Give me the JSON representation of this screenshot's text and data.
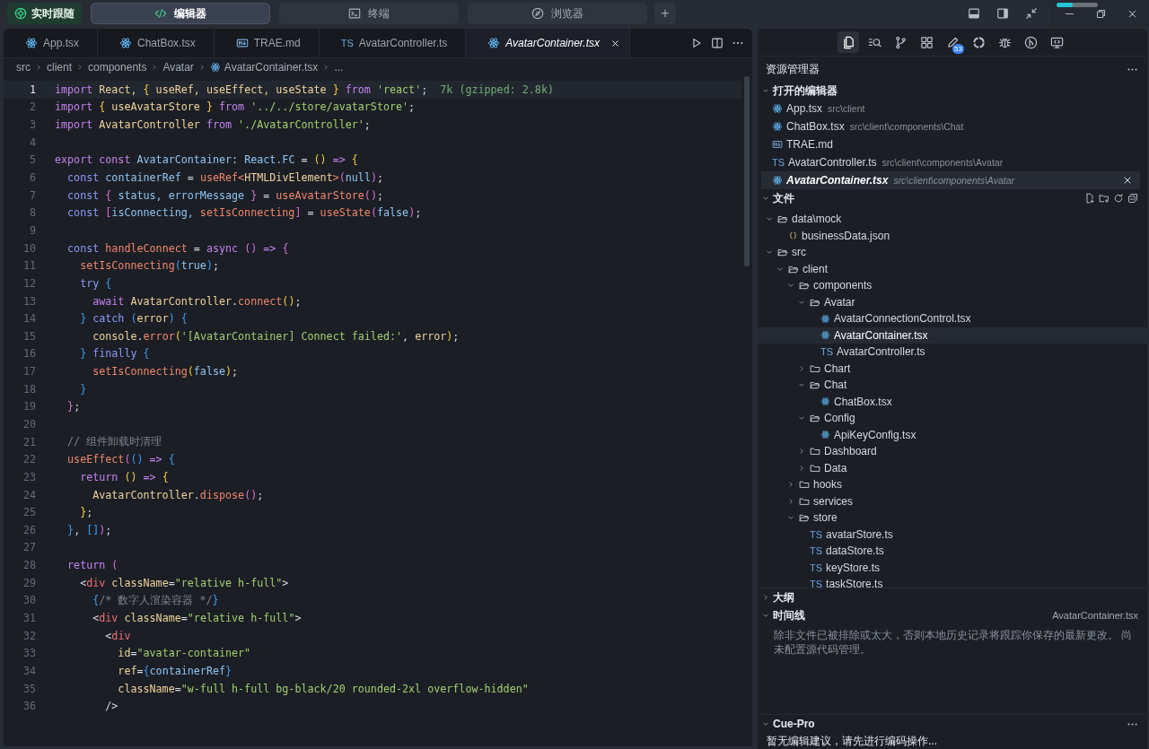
{
  "top_bar": {
    "follow_button": {
      "label": "实时跟随"
    },
    "modes": [
      {
        "label": "编辑器",
        "selected": true
      },
      {
        "label": "终端",
        "selected": false
      },
      {
        "label": "浏览器",
        "selected": false
      }
    ],
    "add_button": {
      "label": "+"
    },
    "progress": {
      "level": 0.4
    }
  },
  "editor": {
    "tabs": [
      {
        "label": "App.tsx",
        "kind": "react",
        "selected": false
      },
      {
        "label": "ChatBox.tsx",
        "kind": "react",
        "selected": false
      },
      {
        "label": "TRAE.md",
        "kind": "markdown",
        "selected": false
      },
      {
        "label": "AvatarController.ts",
        "kind": "typescript",
        "tag": "TS",
        "selected": false
      },
      {
        "label": "AvatarContainer.tsx",
        "kind": "react",
        "selected": true
      }
    ],
    "breadcrumb": [
      {
        "label": "src",
        "kind": "folder"
      },
      {
        "label": "client",
        "kind": "folder"
      },
      {
        "label": "components",
        "kind": "folder"
      },
      {
        "label": "Avatar",
        "kind": "folder"
      },
      {
        "label": "AvatarContainer.tsx",
        "kind": "react"
      },
      {
        "label": "...",
        "kind": "more"
      }
    ],
    "lines": [
      {
        "number": "1",
        "current": true,
        "tokens": [
          {
            "text": "import",
            "kind": "keyword"
          },
          {
            "text": " React, ",
            "kind": "class"
          },
          {
            "text": "{",
            "kind": "brace1"
          },
          {
            "text": " useRef, useEffect, useState ",
            "kind": "class"
          },
          {
            "text": "}",
            "kind": "brace1"
          },
          {
            "text": " from",
            "kind": "keyword"
          },
          {
            "text": " 'react'",
            "kind": "string"
          },
          {
            "text": ";",
            "kind": "plain"
          },
          {
            "text": "  7k (gzipped: 2.8k)",
            "kind": "hint"
          }
        ]
      },
      {
        "number": "2",
        "current": false,
        "tokens": [
          {
            "text": "import",
            "kind": "keyword"
          },
          {
            "text": " {",
            "kind": "brace1"
          },
          {
            "text": " useAvatarStore ",
            "kind": "class"
          },
          {
            "text": "}",
            "kind": "brace1"
          },
          {
            "text": " from",
            "kind": "keyword"
          },
          {
            "text": " '../../store/avatarStore'",
            "kind": "string"
          },
          {
            "text": ";",
            "kind": "plain"
          }
        ]
      },
      {
        "number": "3",
        "current": false,
        "tokens": [
          {
            "text": "import",
            "kind": "keyword"
          },
          {
            "text": " AvatarController",
            "kind": "class"
          },
          {
            "text": " from",
            "kind": "keyword"
          },
          {
            "text": " './AvatarController'",
            "kind": "string"
          },
          {
            "text": ";",
            "kind": "plain"
          }
        ]
      },
      {
        "number": "4",
        "current": false
      },
      {
        "number": "5",
        "current": false,
        "tokens": [
          {
            "text": "export const",
            "kind": "keyword"
          },
          {
            "text": " AvatarContainer",
            "kind": "variable"
          },
          {
            "text": ": ",
            "kind": "plain"
          },
          {
            "text": "React.FC",
            "kind": "variable"
          },
          {
            "text": " = ",
            "kind": "plain"
          },
          {
            "text": "()",
            "kind": "brace1"
          },
          {
            "text": " =>",
            "kind": "keyword"
          },
          {
            "text": " {",
            "kind": "brace1"
          }
        ]
      },
      {
        "number": "6",
        "current": false,
        "tokens": [
          {
            "text": "  const",
            "kind": "declaration"
          },
          {
            "text": " containerRef",
            "kind": "variable"
          },
          {
            "text": " = ",
            "kind": "plain"
          },
          {
            "text": "useRef",
            "kind": "function"
          },
          {
            "text": "<",
            "kind": "function"
          },
          {
            "text": "HTMLDivElement",
            "kind": "class"
          },
          {
            "text": ">",
            "kind": "function"
          },
          {
            "text": "(",
            "kind": "brace2"
          },
          {
            "text": "null",
            "kind": "variable"
          },
          {
            "text": ")",
            "kind": "brace2"
          },
          {
            "text": ";",
            "kind": "plain"
          }
        ]
      },
      {
        "number": "7",
        "current": false,
        "tokens": [
          {
            "text": "  const",
            "kind": "declaration"
          },
          {
            "text": " {",
            "kind": "brace2"
          },
          {
            "text": " status, errorMessage ",
            "kind": "variable"
          },
          {
            "text": "}",
            "kind": "brace2"
          },
          {
            "text": " = ",
            "kind": "plain"
          },
          {
            "text": "useAvatarStore",
            "kind": "function"
          },
          {
            "text": "()",
            "kind": "brace2"
          },
          {
            "text": ";",
            "kind": "plain"
          }
        ]
      },
      {
        "number": "8",
        "current": false,
        "tokens": [
          {
            "text": "  const",
            "kind": "declaration"
          },
          {
            "text": " [",
            "kind": "brace2"
          },
          {
            "text": "isConnecting, ",
            "kind": "variable"
          },
          {
            "text": "setIsConnecting",
            "kind": "function"
          },
          {
            "text": "]",
            "kind": "brace2"
          },
          {
            "text": " = ",
            "kind": "plain"
          },
          {
            "text": "useState",
            "kind": "function"
          },
          {
            "text": "(",
            "kind": "brace2"
          },
          {
            "text": "false",
            "kind": "variable"
          },
          {
            "text": ")",
            "kind": "brace2"
          },
          {
            "text": ";",
            "kind": "plain"
          }
        ]
      },
      {
        "number": "9",
        "current": false
      },
      {
        "number": "10",
        "current": false,
        "tokens": [
          {
            "text": "  const",
            "kind": "declaration"
          },
          {
            "text": " handleConnect",
            "kind": "function"
          },
          {
            "text": " = ",
            "kind": "plain"
          },
          {
            "text": "async",
            "kind": "keyword"
          },
          {
            "text": " ()",
            "kind": "brace2"
          },
          {
            "text": " =>",
            "kind": "keyword"
          },
          {
            "text": " {",
            "kind": "brace2"
          }
        ]
      },
      {
        "number": "11",
        "current": false,
        "tokens": [
          {
            "text": "    setIsConnecting",
            "kind": "function"
          },
          {
            "text": "(",
            "kind": "brace3"
          },
          {
            "text": "true",
            "kind": "variable"
          },
          {
            "text": ")",
            "kind": "brace3"
          },
          {
            "text": ";",
            "kind": "plain"
          }
        ]
      },
      {
        "number": "12",
        "current": false,
        "tokens": [
          {
            "text": "    try",
            "kind": "declaration"
          },
          {
            "text": " {",
            "kind": "brace3"
          }
        ]
      },
      {
        "number": "13",
        "current": false,
        "tokens": [
          {
            "text": "      await",
            "kind": "keyword"
          },
          {
            "text": " AvatarController",
            "kind": "class"
          },
          {
            "text": ".",
            "kind": "plain"
          },
          {
            "text": "connect",
            "kind": "function"
          },
          {
            "text": "()",
            "kind": "brace1"
          },
          {
            "text": ";",
            "kind": "plain"
          }
        ]
      },
      {
        "number": "14",
        "current": false,
        "tokens": [
          {
            "text": "    }",
            "kind": "brace3"
          },
          {
            "text": " catch",
            "kind": "declaration"
          },
          {
            "text": " (",
            "kind": "brace3"
          },
          {
            "text": "error",
            "kind": "class"
          },
          {
            "text": ")",
            "kind": "brace3"
          },
          {
            "text": " {",
            "kind": "brace3"
          }
        ]
      },
      {
        "number": "15",
        "current": false,
        "tokens": [
          {
            "text": "      console",
            "kind": "class"
          },
          {
            "text": ".",
            "kind": "plain"
          },
          {
            "text": "error",
            "kind": "function"
          },
          {
            "text": "(",
            "kind": "brace1"
          },
          {
            "text": "'[AvatarContainer] Connect failed:'",
            "kind": "string"
          },
          {
            "text": ", ",
            "kind": "plain"
          },
          {
            "text": "error",
            "kind": "class"
          },
          {
            "text": ")",
            "kind": "brace1"
          },
          {
            "text": ";",
            "kind": "plain"
          }
        ]
      },
      {
        "number": "16",
        "current": false,
        "tokens": [
          {
            "text": "    }",
            "kind": "brace3"
          },
          {
            "text": " finally",
            "kind": "declaration"
          },
          {
            "text": " {",
            "kind": "brace3"
          }
        ]
      },
      {
        "number": "17",
        "current": false,
        "tokens": [
          {
            "text": "      setIsConnecting",
            "kind": "function"
          },
          {
            "text": "(",
            "kind": "brace1"
          },
          {
            "text": "false",
            "kind": "variable"
          },
          {
            "text": ")",
            "kind": "brace1"
          },
          {
            "text": ";",
            "kind": "plain"
          }
        ]
      },
      {
        "number": "18",
        "current": false,
        "tokens": [
          {
            "text": "    }",
            "kind": "brace3"
          }
        ]
      },
      {
        "number": "19",
        "current": false,
        "tokens": [
          {
            "text": "  }",
            "kind": "brace2"
          },
          {
            "text": ";",
            "kind": "plain"
          }
        ]
      },
      {
        "number": "20",
        "current": false
      },
      {
        "number": "21",
        "current": false,
        "tokens": [
          {
            "text": "  // 组件卸载时清理",
            "kind": "comment"
          }
        ]
      },
      {
        "number": "22",
        "current": false,
        "tokens": [
          {
            "text": "  useEffect",
            "kind": "function"
          },
          {
            "text": "(",
            "kind": "brace2"
          },
          {
            "text": "()",
            "kind": "brace3"
          },
          {
            "text": " =>",
            "kind": "keyword"
          },
          {
            "text": " {",
            "kind": "brace3"
          }
        ]
      },
      {
        "number": "23",
        "current": false,
        "tokens": [
          {
            "text": "    return",
            "kind": "keyword"
          },
          {
            "text": " ()",
            "kind": "brace1"
          },
          {
            "text": " =>",
            "kind": "keyword"
          },
          {
            "text": " {",
            "kind": "brace1"
          }
        ]
      },
      {
        "number": "24",
        "current": false,
        "tokens": [
          {
            "text": "      AvatarController",
            "kind": "class"
          },
          {
            "text": ".",
            "kind": "plain"
          },
          {
            "text": "dispose",
            "kind": "function"
          },
          {
            "text": "()",
            "kind": "brace2"
          },
          {
            "text": ";",
            "kind": "plain"
          }
        ]
      },
      {
        "number": "25",
        "current": false,
        "tokens": [
          {
            "text": "    }",
            "kind": "brace1"
          },
          {
            "text": ";",
            "kind": "plain"
          }
        ]
      },
      {
        "number": "26",
        "current": false,
        "tokens": [
          {
            "text": "  }",
            "kind": "brace3"
          },
          {
            "text": ", ",
            "kind": "plain"
          },
          {
            "text": "[]",
            "kind": "brace3"
          },
          {
            "text": ")",
            "kind": "brace2"
          },
          {
            "text": ";",
            "kind": "plain"
          }
        ]
      },
      {
        "number": "27",
        "current": false
      },
      {
        "number": "28",
        "current": false,
        "tokens": [
          {
            "text": "  return",
            "kind": "keyword"
          },
          {
            "text": " (",
            "kind": "brace2"
          }
        ]
      },
      {
        "number": "29",
        "current": false,
        "tokens": [
          {
            "text": "    <",
            "kind": "plain"
          },
          {
            "text": "div",
            "kind": "tag"
          },
          {
            "text": " className",
            "kind": "attribute"
          },
          {
            "text": "=",
            "kind": "plain"
          },
          {
            "text": "\"relative h-full\"",
            "kind": "string"
          },
          {
            "text": ">",
            "kind": "plain"
          }
        ]
      },
      {
        "number": "30",
        "current": false,
        "tokens": [
          {
            "text": "      {",
            "kind": "brace3"
          },
          {
            "text": "/* 数字人渲染容器 */",
            "kind": "comment"
          },
          {
            "text": "}",
            "kind": "brace3"
          }
        ]
      },
      {
        "number": "31",
        "current": false,
        "tokens": [
          {
            "text": "      <",
            "kind": "plain"
          },
          {
            "text": "div",
            "kind": "tag"
          },
          {
            "text": " className",
            "kind": "attribute"
          },
          {
            "text": "=",
            "kind": "plain"
          },
          {
            "text": "\"relative h-full\"",
            "kind": "string"
          },
          {
            "text": ">",
            "kind": "plain"
          }
        ]
      },
      {
        "number": "32",
        "current": false,
        "tokens": [
          {
            "text": "        <",
            "kind": "plain"
          },
          {
            "text": "div",
            "kind": "tag"
          }
        ]
      },
      {
        "number": "33",
        "current": false,
        "tokens": [
          {
            "text": "          id",
            "kind": "attribute"
          },
          {
            "text": "=",
            "kind": "plain"
          },
          {
            "text": "\"avatar-container\"",
            "kind": "string"
          }
        ]
      },
      {
        "number": "34",
        "current": false,
        "tokens": [
          {
            "text": "          ref",
            "kind": "attribute"
          },
          {
            "text": "=",
            "kind": "plain"
          },
          {
            "text": "{",
            "kind": "brace3"
          },
          {
            "text": "containerRef",
            "kind": "variable"
          },
          {
            "text": "}",
            "kind": "brace3"
          }
        ]
      },
      {
        "number": "35",
        "current": false,
        "tokens": [
          {
            "text": "          className",
            "kind": "attribute"
          },
          {
            "text": "=",
            "kind": "plain"
          },
          {
            "text": "\"w-full h-full bg-black/20 rounded-2xl overflow-hidden\"",
            "kind": "string"
          }
        ]
      },
      {
        "number": "36",
        "current": false,
        "tokens": [
          {
            "text": "        />",
            "kind": "plain"
          }
        ]
      }
    ]
  },
  "sidebar": {
    "activity_bar": [
      {
        "selected": true
      },
      {
        "selected": false
      },
      {
        "selected": false
      },
      {
        "selected": false
      },
      {
        "selected": false,
        "badge": "53"
      },
      {
        "selected": false
      },
      {
        "selected": false
      },
      {
        "selected": false
      },
      {
        "selected": false
      }
    ],
    "title": "资源管理器",
    "open_editors": {
      "title": "打开的编辑器",
      "expanded": true,
      "items": [
        {
          "name": "App.tsx",
          "path": "src\\client",
          "kind": "react",
          "selected": false
        },
        {
          "name": "ChatBox.tsx",
          "path": "src\\client\\components\\Chat",
          "kind": "react",
          "selected": false
        },
        {
          "name": "TRAE.md",
          "kind": "markdown",
          "selected": false
        },
        {
          "name": "AvatarController.ts",
          "path": "src\\client\\components\\Avatar",
          "kind": "typescript",
          "tag": "TS",
          "selected": false
        },
        {
          "name": "AvatarContainer.tsx",
          "path": "src\\client\\components\\Avatar",
          "kind": "react",
          "selected": true
        }
      ]
    },
    "files": {
      "title": "文件",
      "expanded": true,
      "tree": [
        {
          "label": "data\\mock",
          "kind": "folder",
          "expanded": true,
          "selected": false,
          "children": [
            {
              "label": "businessData.json",
              "kind": "json",
              "selected": false
            }
          ]
        },
        {
          "label": "src",
          "kind": "folder",
          "expanded": true,
          "selected": false,
          "children": [
            {
              "label": "client",
              "kind": "folder",
              "expanded": true,
              "selected": false,
              "children": [
                {
                  "label": "components",
                  "kind": "folder",
                  "expanded": true,
                  "selected": false,
                  "children": [
                    {
                      "label": "Avatar",
                      "kind": "folder",
                      "expanded": true,
                      "selected": false,
                      "children": [
                        {
                          "label": "AvatarConnectionControl.tsx",
                          "kind": "react",
                          "selected": false
                        },
                        {
                          "label": "AvatarContainer.tsx",
                          "kind": "react",
                          "selected": true
                        },
                        {
                          "label": "AvatarController.ts",
                          "kind": "typescript",
                          "tag": "TS",
                          "selected": false
                        }
                      ]
                    },
                    {
                      "label": "Chart",
                      "kind": "folder",
                      "expanded": false,
                      "selected": false
                    },
                    {
                      "label": "Chat",
                      "kind": "folder",
                      "expanded": true,
                      "selected": false,
                      "children": [
                        {
                          "label": "ChatBox.tsx",
                          "kind": "react",
                          "selected": false
                        }
                      ]
                    },
                    {
                      "label": "Config",
                      "kind": "folder",
                      "expanded": true,
                      "selected": false,
                      "children": [
                        {
                          "label": "ApiKeyConfig.tsx",
                          "kind": "react",
                          "selected": false
                        }
                      ]
                    },
                    {
                      "label": "Dashboard",
                      "kind": "folder",
                      "expanded": false,
                      "selected": false
                    },
                    {
                      "label": "Data",
                      "kind": "folder",
                      "expanded": false,
                      "selected": false
                    }
                  ]
                },
                {
                  "label": "hooks",
                  "kind": "folder",
                  "expanded": false,
                  "selected": false
                },
                {
                  "label": "services",
                  "kind": "folder",
                  "expanded": false,
                  "selected": false
                },
                {
                  "label": "store",
                  "kind": "folder",
                  "expanded": true,
                  "selected": false,
                  "children": [
                    {
                      "label": "avatarStore.ts",
                      "kind": "typescript",
                      "tag": "TS",
                      "selected": false
                    },
                    {
                      "label": "dataStore.ts",
                      "kind": "typescript",
                      "tag": "TS",
                      "selected": false
                    },
                    {
                      "label": "keyStore.ts",
                      "kind": "typescript",
                      "tag": "TS",
                      "selected": false
                    },
                    {
                      "label": "taskStore.ts",
                      "kind": "typescript",
                      "tag": "TS",
                      "selected": false
                    }
                  ]
                }
              ]
            }
          ]
        }
      ]
    },
    "outline": {
      "title": "大纲",
      "expanded": false
    },
    "timeline": {
      "title": "时间线",
      "expanded": true,
      "file": "AvatarContainer.tsx",
      "message": "除非文件已被排除或太大，否则本地历史记录将跟踪你保存的最新更改。 尚未配置源代码管理。"
    },
    "cue_pro": {
      "title": "Cue-Pro",
      "expanded": true,
      "message": "暂无编辑建议，请先进行编码操作..."
    }
  }
}
